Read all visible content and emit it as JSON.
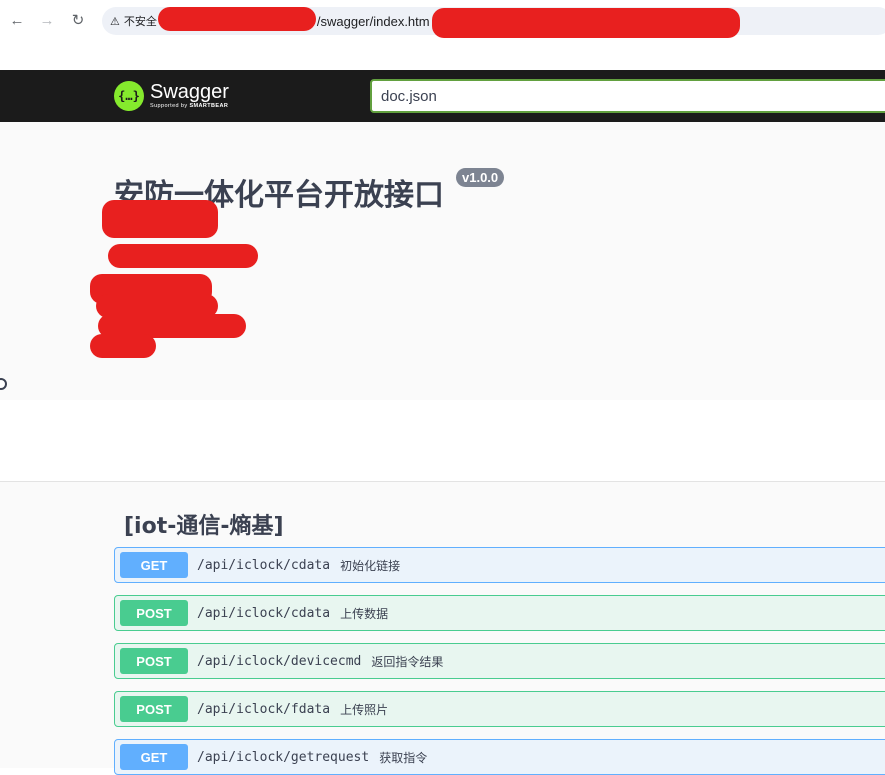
{
  "browser": {
    "back_icon": "←",
    "forward_icon": "→",
    "reload_icon": "↻",
    "security_icon": "⚠",
    "security_label": "不安全",
    "url_visible": "/swagger/index.htm"
  },
  "topbar": {
    "logo_glyph": "{…}",
    "logo_name": "Swagger",
    "logo_sub_prefix": "Supported by ",
    "logo_sub_brand": "SMARTBEAR",
    "spec_url": "doc.json"
  },
  "info": {
    "title": "安防一体化平台开放接口",
    "version": "v1.0.0"
  },
  "tag": {
    "name": "[iot-通信-熵基]"
  },
  "operations": [
    {
      "method": "GET",
      "path": "/api/iclock/cdata",
      "summary": "初始化链接"
    },
    {
      "method": "POST",
      "path": "/api/iclock/cdata",
      "summary": "上传数据"
    },
    {
      "method": "POST",
      "path": "/api/iclock/devicecmd",
      "summary": "返回指令结果"
    },
    {
      "method": "POST",
      "path": "/api/iclock/fdata",
      "summary": "上传照片"
    },
    {
      "method": "GET",
      "path": "/api/iclock/getrequest",
      "summary": "获取指令"
    }
  ],
  "colors": {
    "get": "#61affe",
    "post": "#49cc90",
    "topbar": "#1b1b1b",
    "logo": "#85ea2d",
    "redaction": "#e8201f"
  }
}
